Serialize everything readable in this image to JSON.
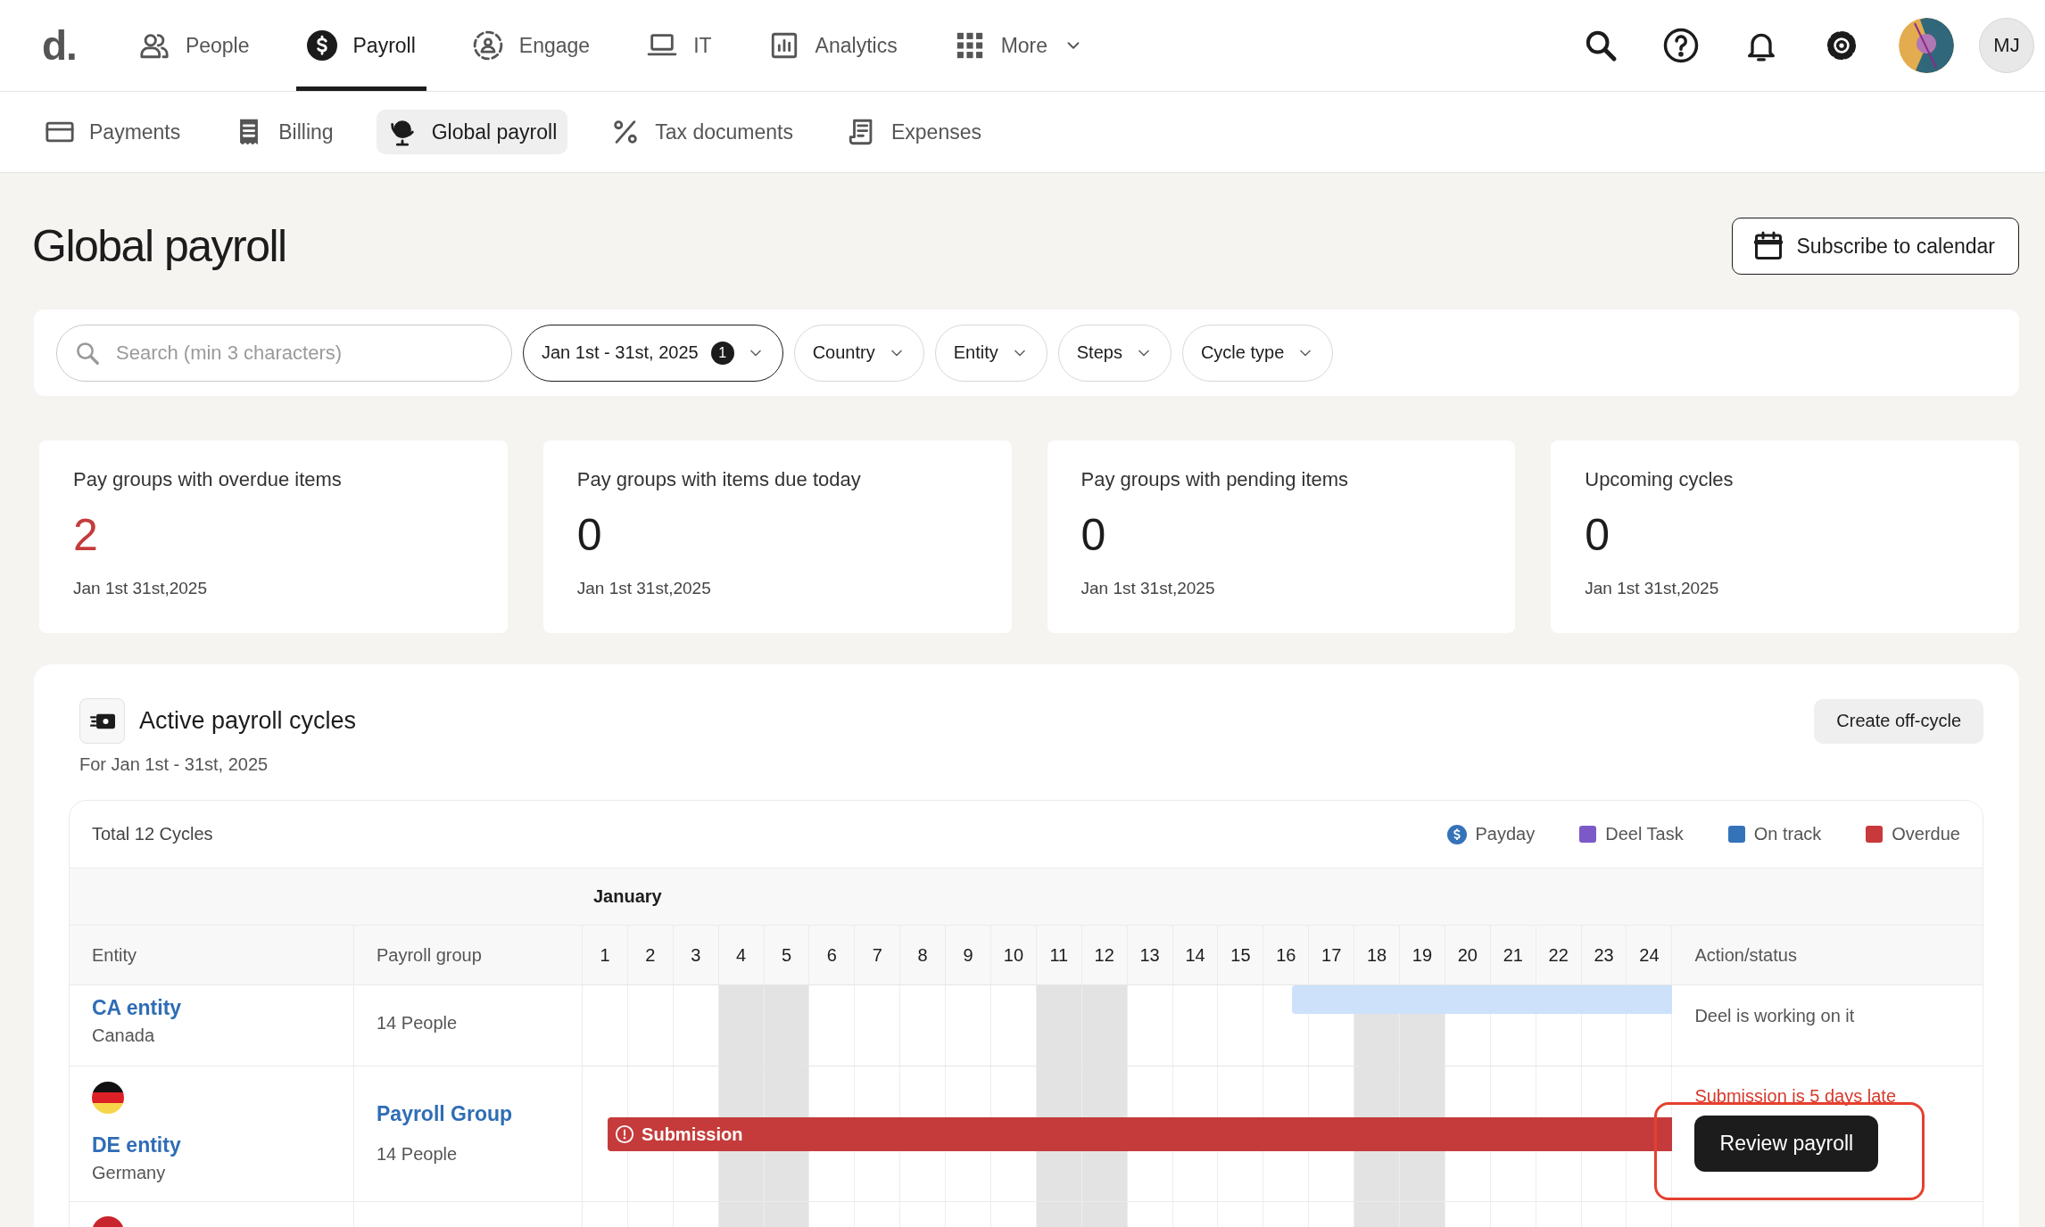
{
  "top_nav": {
    "logo": "d.",
    "items": [
      {
        "label": "People",
        "selected": false,
        "dropdown": false
      },
      {
        "label": "Payroll",
        "selected": true,
        "dropdown": false
      },
      {
        "label": "Engage",
        "selected": false,
        "dropdown": false
      },
      {
        "label": "IT",
        "selected": false,
        "dropdown": false
      },
      {
        "label": "Analytics",
        "selected": false,
        "dropdown": false
      },
      {
        "label": "More",
        "selected": false,
        "dropdown": true
      }
    ],
    "user_initials": "MJ"
  },
  "sub_nav": [
    {
      "label": "Payments",
      "selected": false
    },
    {
      "label": "Billing",
      "selected": false
    },
    {
      "label": "Global payroll",
      "selected": true
    },
    {
      "label": "Tax documents",
      "selected": false
    },
    {
      "label": "Expenses",
      "selected": false
    }
  ],
  "page_title": "Global payroll",
  "subscribe_button": "Subscribe to calendar",
  "filters": {
    "search_placeholder": "Search (min 3 characters)",
    "chips": [
      {
        "label": "Jan 1st - 31st, 2025",
        "badge": "1",
        "selected": true
      },
      {
        "label": "Country",
        "selected": false
      },
      {
        "label": "Entity",
        "selected": false
      },
      {
        "label": "Steps",
        "selected": false
      },
      {
        "label": "Cycle type",
        "selected": false
      }
    ]
  },
  "stats": [
    {
      "title": "Pay groups with overdue items",
      "value": "2",
      "alert": true,
      "date": "Jan 1st 31st,2025"
    },
    {
      "title": "Pay groups with items due today",
      "value": "0",
      "alert": false,
      "date": "Jan 1st 31st,2025"
    },
    {
      "title": "Pay groups with pending items",
      "value": "0",
      "alert": false,
      "date": "Jan 1st 31st,2025"
    },
    {
      "title": "Upcoming cycles",
      "value": "0",
      "alert": false,
      "date": "Jan 1st 31st,2025"
    }
  ],
  "cycles": {
    "title": "Active payroll cycles",
    "subtitle": "For Jan 1st - 31st, 2025",
    "create_button": "Create off-cycle",
    "total": "Total 12 Cycles",
    "legend": [
      {
        "label": "Payday",
        "kind": "payday",
        "color": "#3573b9"
      },
      {
        "label": "Deel Task",
        "kind": "swatch",
        "color": "#7b5ac8"
      },
      {
        "label": "On track",
        "kind": "swatch",
        "color": "#3573b9"
      },
      {
        "label": "Overdue",
        "kind": "swatch",
        "color": "#c8393b"
      }
    ],
    "month": "January",
    "columns": {
      "entity": "Entity",
      "group": "Payroll group",
      "action": "Action/status"
    },
    "days": [
      {
        "label": "1",
        "weekend": false
      },
      {
        "label": "2",
        "weekend": false
      },
      {
        "label": "3",
        "weekend": false
      },
      {
        "label": "4",
        "weekend": true
      },
      {
        "label": "5",
        "weekend": true
      },
      {
        "label": "6",
        "weekend": false
      },
      {
        "label": "7",
        "weekend": false
      },
      {
        "label": "8",
        "weekend": false
      },
      {
        "label": "9",
        "weekend": false
      },
      {
        "label": "10",
        "weekend": false
      },
      {
        "label": "11",
        "weekend": true
      },
      {
        "label": "12",
        "weekend": true
      },
      {
        "label": "13",
        "weekend": false
      },
      {
        "label": "14",
        "weekend": false
      },
      {
        "label": "15",
        "weekend": false
      },
      {
        "label": "16",
        "weekend": false
      },
      {
        "label": "17",
        "weekend": false
      },
      {
        "label": "18",
        "weekend": true
      },
      {
        "label": "19",
        "weekend": true
      },
      {
        "label": "20",
        "weekend": false
      },
      {
        "label": "21",
        "weekend": false
      },
      {
        "label": "22",
        "weekend": false
      },
      {
        "label": "23",
        "weekend": false
      },
      {
        "label": "24",
        "weekend": false
      }
    ],
    "rows": [
      {
        "kind": "scrolled",
        "entity": "CA entity",
        "country": "Canada",
        "group_size": "14 People",
        "bar": {
          "kind": "on_track",
          "level": 0.349
        },
        "status": {
          "kind": "info",
          "text": "Deel is working on it"
        }
      },
      {
        "kind": "full",
        "flag": {
          "kind": "de"
        },
        "entity": "DE entity",
        "country": "Germany",
        "group": "Payroll Group",
        "group_size": "14 People",
        "bar": {
          "kind": "overdue",
          "level": 0.977,
          "label": "Submission"
        },
        "status": {
          "kind": "late",
          "text": "Submission is 5 days late"
        },
        "action": "Review payroll",
        "highlighted": true
      },
      {
        "kind": "cut",
        "flag": {
          "kind": "red"
        }
      }
    ]
  }
}
